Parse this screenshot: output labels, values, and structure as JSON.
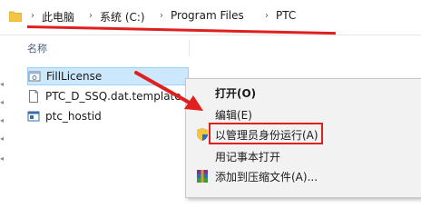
{
  "address_bar": {
    "crumbs": [
      "此电脑",
      "系统 (C:)",
      "Program Files",
      "PTC"
    ]
  },
  "file_list": {
    "column_header": "名称",
    "files": [
      {
        "name": "FillLicense",
        "icon": "app-icon",
        "selected": true
      },
      {
        "name": "PTC_D_SSQ.dat.template",
        "icon": "document-icon",
        "selected": false
      },
      {
        "name": "ptc_hostid",
        "icon": "app-window-icon",
        "selected": false
      }
    ]
  },
  "context_menu": {
    "items": [
      {
        "label": "打开(O)",
        "bold": true,
        "icon": null
      },
      {
        "label": "编辑(E)",
        "bold": false,
        "icon": null
      },
      {
        "label": "以管理员身份运行(A)",
        "bold": false,
        "icon": "uac-shield-icon",
        "highlighted": true
      },
      {
        "label": "用记事本打开",
        "bold": false,
        "icon": null
      },
      {
        "label": "添加到压缩文件(A)...",
        "bold": false,
        "icon": "winrar-icon"
      }
    ]
  },
  "colors": {
    "annotation_red": "#e0201e",
    "selection_bg": "#cce8ff",
    "menu_bg": "#f2f2f2"
  }
}
